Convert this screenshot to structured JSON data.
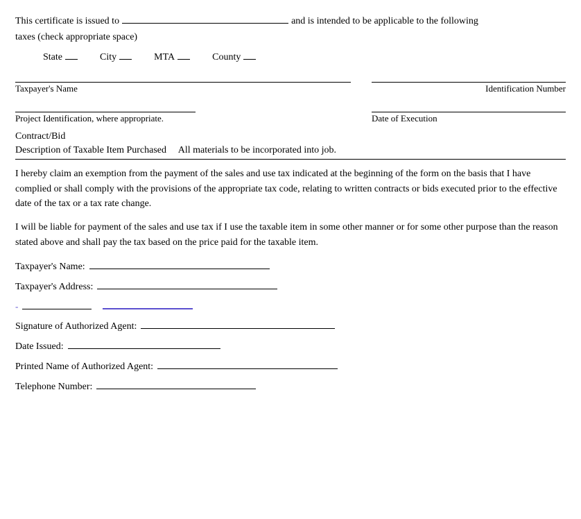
{
  "intro": {
    "line1_before": "This certificate is issued to",
    "line1_after": "and is intended to be applicable to the following",
    "line2": "taxes (check appropriate space)"
  },
  "checkboxes": {
    "state_label": "State",
    "city_label": "City",
    "mta_label": "MTA",
    "county_label": "County"
  },
  "fields": {
    "taxpayers_name_label": "Taxpayer's Name",
    "identification_number_label": "Identification Number",
    "project_id_label": "Project Identification, where appropriate.",
    "date_execution_label": "Date of Execution",
    "contract_bid_label": "Contract/Bid",
    "description_label": "Description of Taxable Item Purchased",
    "description_value": "All materials to be incorporated into job."
  },
  "body": {
    "paragraph1": "I hereby claim an exemption from the payment of the sales and use tax indicated at the beginning of the form on the basis that I have complied or shall comply with the provisions of the appropriate tax code, relating to written contracts or bids executed prior to the effective date of the tax or a tax rate change.",
    "paragraph2": "I will be liable for payment of the sales and use tax if I use the taxable item in some other manner or for some other purpose than the reason stated above and shall pay the tax based on the price paid for the taxable item."
  },
  "signature": {
    "taxpayers_name_label": "Taxpayer's Name:",
    "taxpayers_address_label": "Taxpayer's Address:",
    "signature_agent_label": "Signature of Authorized Agent:",
    "date_issued_label": "Date Issued:",
    "printed_name_label": "Printed Name of Authorized Agent:",
    "telephone_label": "Telephone Number:"
  }
}
